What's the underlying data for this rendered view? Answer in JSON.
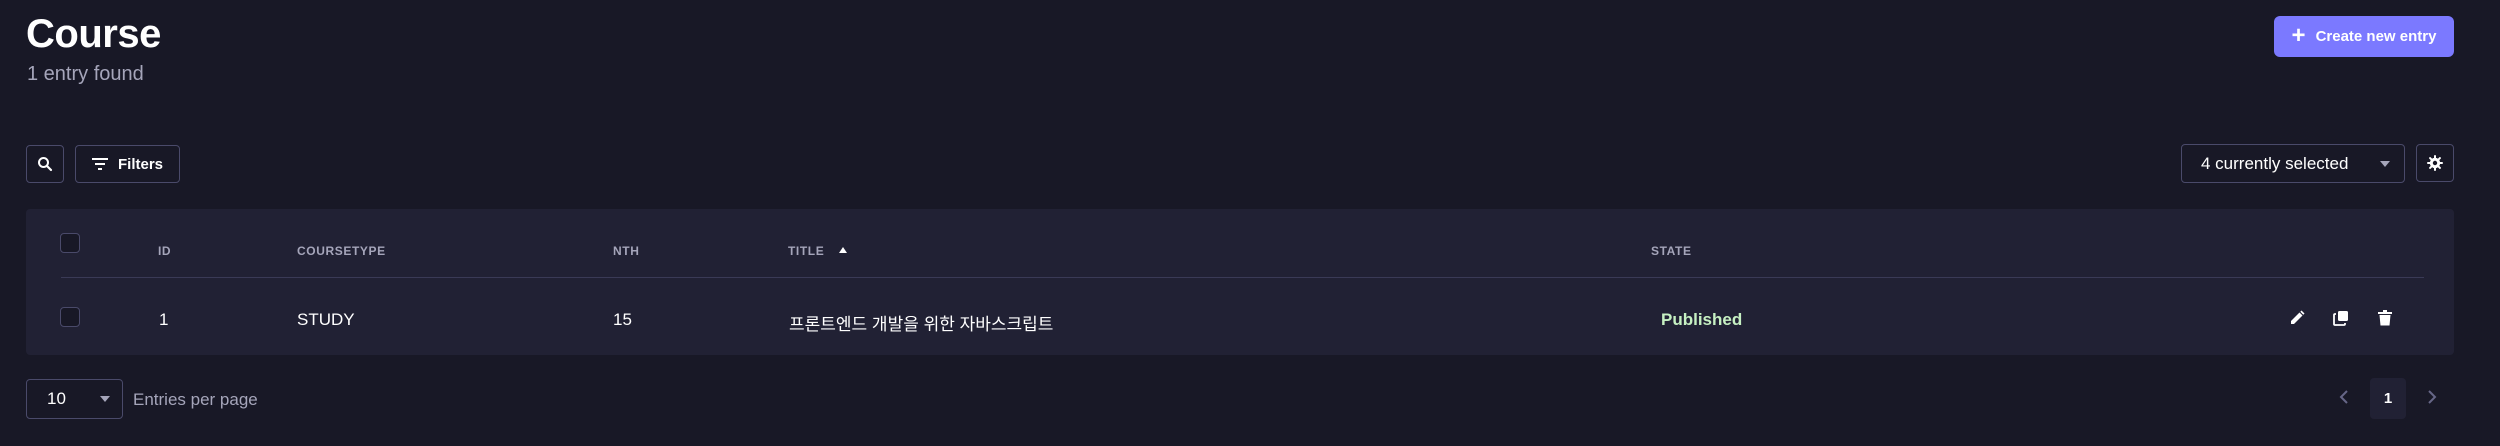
{
  "header": {
    "title": "Course",
    "subtitle": "1 entry found",
    "create_label": "Create new entry"
  },
  "toolbar": {
    "filters_label": "Filters",
    "columns_selected": "4 currently selected"
  },
  "table": {
    "columns": [
      "ID",
      "COURSETYPE",
      "NTH",
      "TITLE",
      "STATE"
    ],
    "sorted_column": "TITLE",
    "sort_direction": "ascending",
    "rows": [
      {
        "id": "1",
        "coursetype": "STUDY",
        "nth": "15",
        "title": "프론트엔드 개발을 위한 자바스크립트",
        "state": "Published"
      }
    ]
  },
  "pagination": {
    "per_page": "10",
    "per_page_label": "Entries per page",
    "current_page": "1"
  },
  "colors": {
    "background": "#181826",
    "surface": "#212134",
    "primary": "#7b79ff",
    "published": "#c6f0c2",
    "muted_text": "#a5a5ba"
  }
}
